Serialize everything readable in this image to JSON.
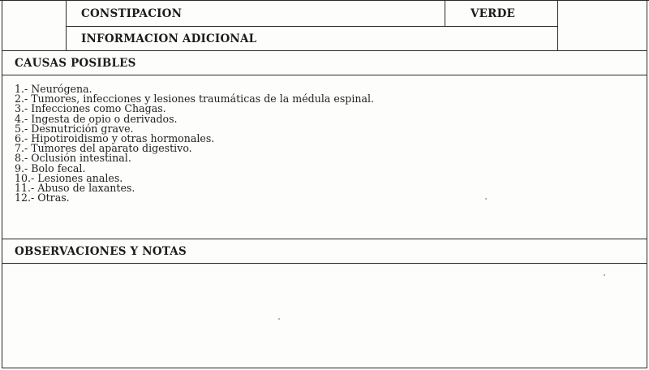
{
  "header": {
    "title": "CONSTIPACION",
    "color_label": "VERDE",
    "subtitle": "INFORMACION ADICIONAL"
  },
  "sections": {
    "causes_heading": "CAUSAS POSIBLES",
    "observations_heading": "OBSERVACIONES Y NOTAS"
  },
  "causes": [
    "1.- Neurógena.",
    "2.- Tumores, infecciones y lesiones traumáticas de la médula espinal.",
    "3.- Infecciones como Chagas.",
    "4.- Ingesta de opio o derivados.",
    "5.- Desnutrición grave.",
    "6.- Hipotiroidismo y otras hormonales.",
    "7.- Tumores del aparato digestivo.",
    "8.- Oclusión intestinal.",
    "9.- Bolo fecal.",
    "10.- Lesiones anales.",
    "11.- Abuso de laxantes.",
    "12.- Otras."
  ],
  "colors": {
    "rule": "#2a2a2a",
    "paper": "#fdfdfc",
    "ink": "#1c1c1c"
  }
}
